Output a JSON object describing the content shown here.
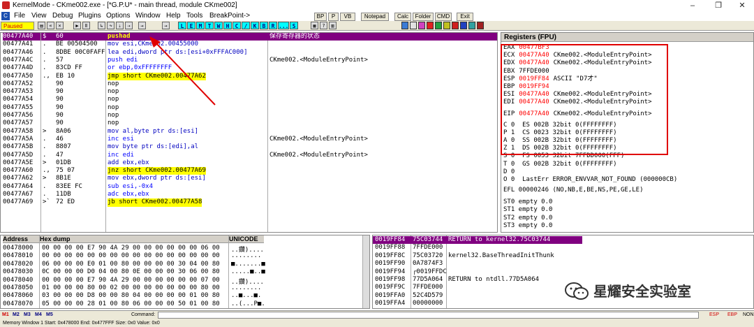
{
  "window": {
    "title": "KernelMode - CKme002.exe - [*G.P.U* - main thread, module CKme002]",
    "min": "–",
    "restore": "❐",
    "close": "✕"
  },
  "menu": [
    "File",
    "View",
    "Debug",
    "Plugins",
    "Options",
    "Window",
    "Help",
    "Tools",
    "BreakPoint->"
  ],
  "plugin_buttons": [
    "BP",
    "P",
    "VB",
    "Notepad",
    "Calc",
    "Folder",
    "CMD",
    "Exit"
  ],
  "toolbar": {
    "status": "Paused",
    "letters": [
      "L",
      "E",
      "M",
      "T",
      "W",
      "H",
      "C",
      "/",
      "K",
      "B",
      "R",
      "...",
      "S"
    ]
  },
  "cpu_rows": [
    {
      "addr": "00477A40",
      "mark": "$",
      "hex": "60",
      "asm": "pushad",
      "cmt": "保存寄存器的状态",
      "style": "sel"
    },
    {
      "addr": "00477A41",
      "mark": ".",
      "hex": "BE 00504500",
      "asm": "mov esi,CKme002.00455000",
      "cmt": ""
    },
    {
      "addr": "00477A46",
      "mark": ".",
      "hex": "8DBE 00C0FAFF",
      "asm": "lea edi,dword ptr ds:[esi+0xFFFAC000]",
      "cmt": ""
    },
    {
      "addr": "00477A4C",
      "mark": ".",
      "hex": "57",
      "asm": "push edi",
      "cmt": "CKme002.<ModuleEntryPoint>"
    },
    {
      "addr": "00477A4D",
      "mark": ".",
      "hex": "83CD FF",
      "asm": "or ebp,0xFFFFFFFF",
      "cmt": ""
    },
    {
      "addr": "00477A50",
      "mark": ".,",
      "hex": "EB 10",
      "asm": "jmp short CKme002.00477A62",
      "cmt": ""
    },
    {
      "addr": "00477A52",
      "mark": "",
      "hex": "90",
      "asm": "nop",
      "cmt": ""
    },
    {
      "addr": "00477A53",
      "mark": "",
      "hex": "90",
      "asm": "nop",
      "cmt": ""
    },
    {
      "addr": "00477A54",
      "mark": "",
      "hex": "90",
      "asm": "nop",
      "cmt": ""
    },
    {
      "addr": "00477A55",
      "mark": "",
      "hex": "90",
      "asm": "nop",
      "cmt": ""
    },
    {
      "addr": "00477A56",
      "mark": "",
      "hex": "90",
      "asm": "nop",
      "cmt": ""
    },
    {
      "addr": "00477A57",
      "mark": "",
      "hex": "90",
      "asm": "nop",
      "cmt": ""
    },
    {
      "addr": "00477A58",
      "mark": ">",
      "hex": "8A06",
      "asm": "mov al,byte ptr ds:[esi]",
      "cmt": ""
    },
    {
      "addr": "00477A5A",
      "mark": ".",
      "hex": "46",
      "asm": "inc esi",
      "cmt": "CKme002.<ModuleEntryPoint>"
    },
    {
      "addr": "00477A5B",
      "mark": ".",
      "hex": "8807",
      "asm": "mov byte ptr ds:[edi],al",
      "cmt": ""
    },
    {
      "addr": "00477A5D",
      "mark": ".",
      "hex": "47",
      "asm": "inc edi",
      "cmt": "CKme002.<ModuleEntryPoint>"
    },
    {
      "addr": "00477A5E",
      "mark": ">",
      "hex": "01DB",
      "asm": "add ebx,ebx",
      "cmt": ""
    },
    {
      "addr": "00477A60",
      "mark": ".,",
      "hex": "75 07",
      "asm": "jnz short CKme002.00477A69",
      "cmt": ""
    },
    {
      "addr": "00477A62",
      "mark": ">",
      "hex": "8B1E",
      "asm": "mov ebx,dword ptr ds:[esi]",
      "cmt": ""
    },
    {
      "addr": "00477A64",
      "mark": ".",
      "hex": "83EE FC",
      "asm": "sub esi,-0x4",
      "cmt": ""
    },
    {
      "addr": "00477A67",
      "mark": ".",
      "hex": "11DB",
      "asm": "adc ebx,ebx",
      "cmt": ""
    },
    {
      "addr": "00477A69",
      "mark": ">`",
      "hex": "72 ED",
      "asm": "jb short CKme002.00477A58",
      "cmt": ""
    }
  ],
  "registers": {
    "title": "Registers (FPU)",
    "lines": [
      {
        "name": "EAX",
        "val": "00477BF3",
        "info": ""
      },
      {
        "name": "ECX",
        "val": "00477A40",
        "info": "CKme002.<ModuleEntryPoint>"
      },
      {
        "name": "EDX",
        "val": "00477A40",
        "info": "CKme002.<ModuleEntryPoint>"
      },
      {
        "name": "EBX",
        "val": "7FFDE000",
        "info": ""
      },
      {
        "name": "ESP",
        "val": "0019FF84",
        "info": "ASCII \"D7才\""
      },
      {
        "name": "EBP",
        "val": "0019FF94",
        "info": ""
      },
      {
        "name": "ESI",
        "val": "00477A40",
        "info": "CKme002.<ModuleEntryPoint>"
      },
      {
        "name": "EDI",
        "val": "00477A40",
        "info": "CKme002.<ModuleEntryPoint>"
      },
      {
        "name": "EIP",
        "val": "00477A40",
        "info": "CKme002.<ModuleEntryPoint>"
      }
    ],
    "flags": [
      "C 0  ES 002B 32bit 0(FFFFFFFF)",
      "P 1  CS 0023 32bit 0(FFFFFFFF)",
      "A 0  SS 002B 32bit 0(FFFFFFFF)",
      "Z 1  DS 002B 32bit 0(FFFFFFFF)",
      "S 0  FS 0053 32bit 7FFDD000(FFF)",
      "T 0  GS 002B 32bit 0(FFFFFFFF)",
      "D 0",
      "O 0  LastErr ERROR_ENVVAR_NOT_FOUND (000000CB)"
    ],
    "efl": "EFL 00000246 (NO,NB,E,BE,NS,PE,GE,LE)",
    "fpu": [
      "ST0 empty 0.0",
      "ST1 empty 0.0",
      "ST2 empty 0.0",
      "ST3 empty 0.0"
    ]
  },
  "dump": {
    "headers": [
      "Address",
      "Hex dump",
      "UNICODE"
    ],
    "rows": [
      {
        "addr": "00478000",
        "hex": "00 00 00 00 E7 90 4A 29 00 00 00 00 00 00 06 00",
        "uni": "..鑽)...."
      },
      {
        "addr": "00478010",
        "hex": "00 00 00 00 00 00 00 00 00 00 00 00 00 00 00 00",
        "uni": "........"
      },
      {
        "addr": "00478020",
        "hex": "06 00 00 00 E0 01 00 80 00 00 00 00 30 04 00 80",
        "uni": "■.......■"
      },
      {
        "addr": "00478030",
        "hex": "0C 00 00 00 D0 04 00 80 0E 00 00 00 30 06 00 80",
        "uni": ".....■..■"
      },
      {
        "addr": "00478040",
        "hex": "00 00 00 00 E7 90 4A 29 00 00 00 00 00 00 07 00",
        "uni": "..鑽)...."
      },
      {
        "addr": "00478050",
        "hex": "01 00 00 00 80 00 02 00 00 00 00 00 00 00 80 00",
        "uni": "........"
      },
      {
        "addr": "00478060",
        "hex": "03 00 00 00 D8 00 00 80 04 00 00 00 00 01 00 80",
        "uni": "..■...■."
      },
      {
        "addr": "00478070",
        "hex": "05 00 00 00 28 01 00 80 06 00 00 00 50 01 00 80",
        "uni": "..(...P■."
      }
    ]
  },
  "stack": {
    "rows": [
      {
        "addr": "0019FF84",
        "val": "75C03744",
        "cmt": "RETURN to kernel32.75C03744",
        "sel": true
      },
      {
        "addr": "0019FF88",
        "val": "7FFDE000",
        "cmt": ""
      },
      {
        "addr": "0019FF8C",
        "val": "75C03720",
        "cmt": "kernel32.BaseThreadInitThunk"
      },
      {
        "addr": "0019FF90",
        "val": "0A7874F3",
        "cmt": ""
      },
      {
        "addr": "0019FF94",
        "val": "┌0019FFDC",
        "cmt": ""
      },
      {
        "addr": "0019FF98",
        "val": "77D5A064",
        "cmt": "RETURN to ntdll.77D5A064"
      },
      {
        "addr": "0019FF9C",
        "val": "7FFDE000",
        "cmt": ""
      },
      {
        "addr": "0019FFA0",
        "val": "52C4D579",
        "cmt": ""
      },
      {
        "addr": "0019FFA4",
        "val": "00000000",
        "cmt": ""
      }
    ]
  },
  "cmdbar": {
    "tabs": [
      "M1",
      "M2",
      "M3",
      "M4",
      "M5"
    ],
    "label": "Command:",
    "right": [
      "ESP",
      "EBP",
      "NONE"
    ]
  },
  "statusbar": "Memory Window 1  Start: 0x478000  End: 0x477FFF  Size: 0x0 Value: 0x0",
  "watermark": "星耀安全实验室",
  "colors": {
    "selection": "#800080",
    "highlight": "#ffff00",
    "annotation": "#e00000",
    "addr_red": "#ff0000"
  }
}
